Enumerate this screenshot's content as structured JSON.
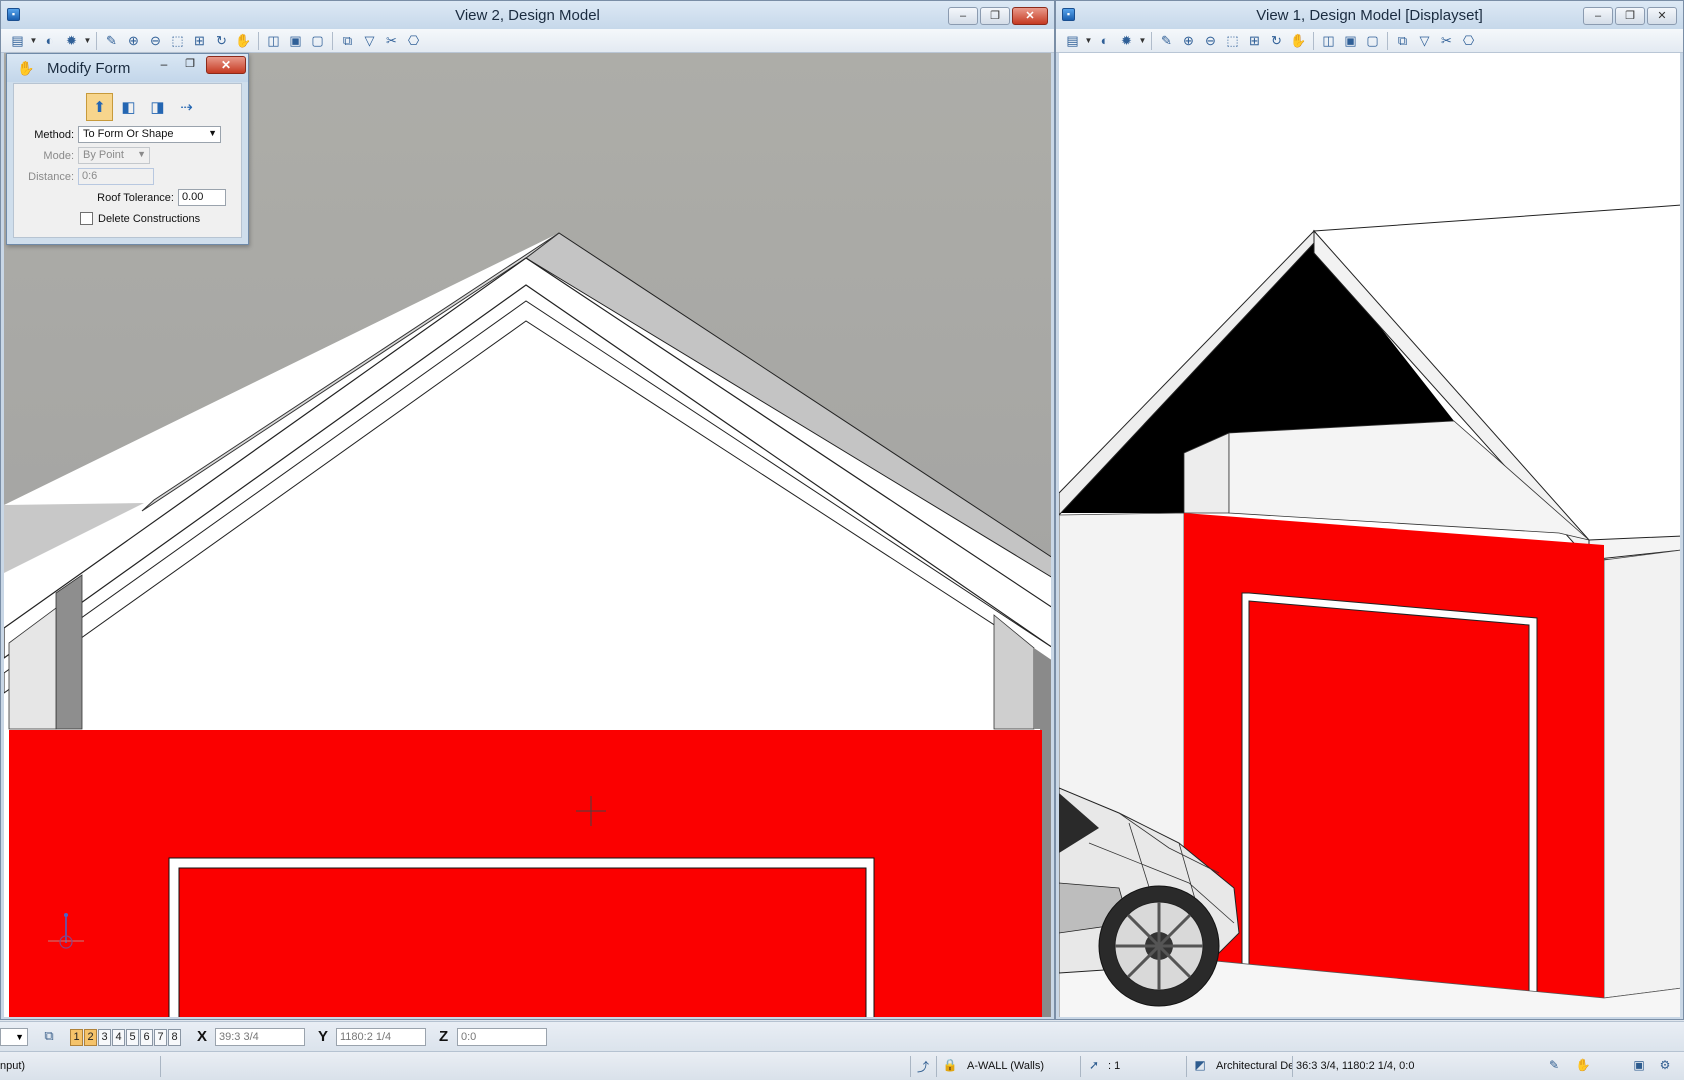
{
  "views": {
    "view2": {
      "title": "View 2, Design Model"
    },
    "view1": {
      "title": "View 1, Design Model [Displayset]"
    }
  },
  "window_buttons": {
    "minimize": "–",
    "restore": "❐",
    "close": "✕"
  },
  "toolbar_icons": [
    "view-attributes-icon",
    "display-style-icon",
    "lights-icon",
    "update-view-icon",
    "zoom-in-icon",
    "zoom-out-icon",
    "window-area-icon",
    "fit-view-icon",
    "rotate-view-icon",
    "pan-view-icon",
    "previous-view-icon",
    "next-view-icon",
    "copy-view-icon",
    "clip-volume-icon",
    "clip-mask-icon",
    "display-filter-icon",
    "camera-icon"
  ],
  "modify_form": {
    "title": "Modify Form",
    "method": {
      "label": "Method:",
      "value": "To Form Or Shape"
    },
    "mode": {
      "label": "Mode:",
      "value": "By Point"
    },
    "distance": {
      "label": "Distance:",
      "value": "0:6"
    },
    "roof_tolerance": {
      "label": "Roof Tolerance:",
      "value": "0.00"
    },
    "delete_constructions": {
      "label": "Delete Constructions",
      "checked": false
    }
  },
  "statusbar": {
    "view_buttons": [
      "1",
      "2",
      "3",
      "4",
      "5",
      "6",
      "7",
      "8"
    ],
    "active_views": [
      "1",
      "2"
    ],
    "x": {
      "label": "X",
      "value": "39:3 3/4"
    },
    "y": {
      "label": "Y",
      "value": "1180:2 1/4"
    },
    "z": {
      "label": "Z",
      "value": "0:0"
    },
    "prompt": "nput)",
    "level": "A-WALL (Walls)",
    "selection_count": ": 1",
    "model": "Architectural De",
    "location": "36:3 3/4, 1180:2 1/4, 0:0"
  },
  "colors": {
    "wall_red": "#fb0000",
    "sky_gray": "#a9a9a4",
    "frame": "#c9d7e6"
  }
}
